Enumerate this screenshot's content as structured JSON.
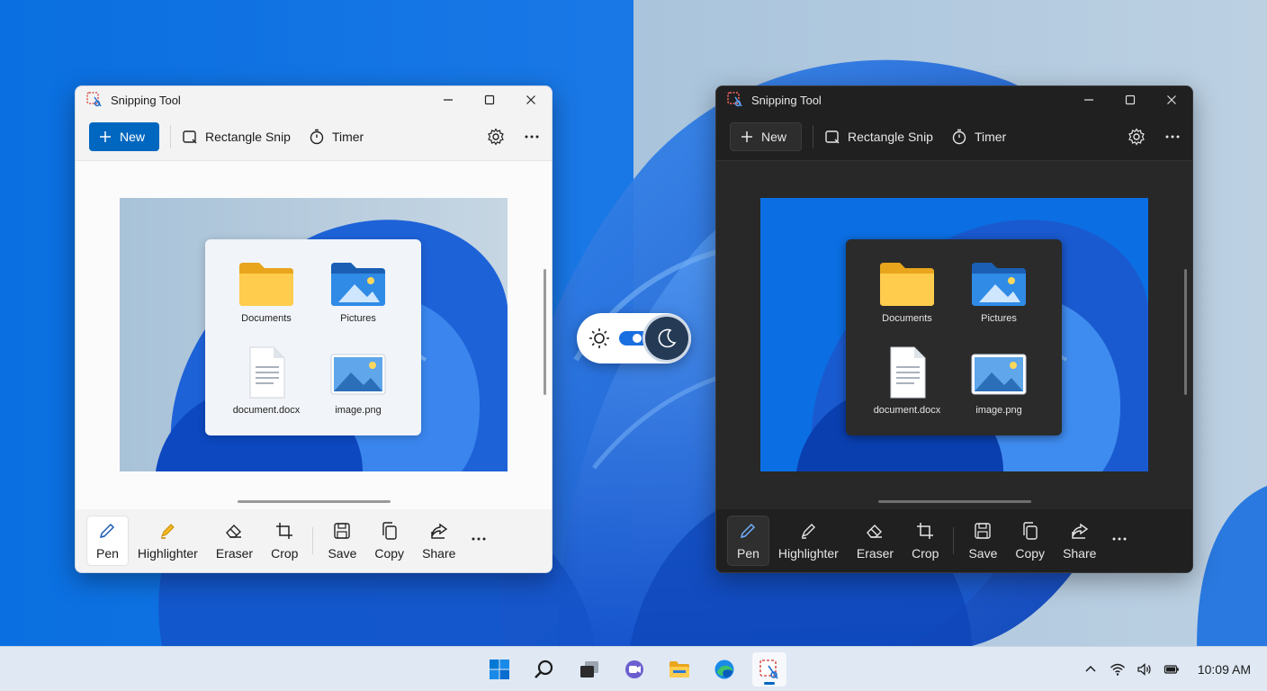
{
  "app": {
    "title": "Snipping Tool"
  },
  "toolbar": {
    "new_label": "New",
    "snip_mode_label": "Rectangle Snip",
    "timer_label": "Timer"
  },
  "bottom_toolbar": {
    "pen": "Pen",
    "highlighter": "Highlighter",
    "eraser": "Eraser",
    "crop": "Crop",
    "save": "Save",
    "copy": "Copy",
    "share": "Share"
  },
  "captured_folder": {
    "items": [
      "Documents",
      "Pictures",
      "document.docx",
      "image.png"
    ]
  },
  "theme_toggle": {
    "left_icon": "sun-icon",
    "right_icon": "moon-icon",
    "state": "dark"
  },
  "taskbar": {
    "apps": [
      "start-icon",
      "search-icon",
      "task-view-icon",
      "chat-icon",
      "file-explorer-icon",
      "edge-icon",
      "snipping-tool-icon"
    ],
    "clock": "10:09 AM"
  },
  "colors": {
    "accent": "#0067c0",
    "light_window": "#f3f3f3",
    "dark_window": "#202020",
    "wallpaper_blue": "#0b6fe3"
  }
}
